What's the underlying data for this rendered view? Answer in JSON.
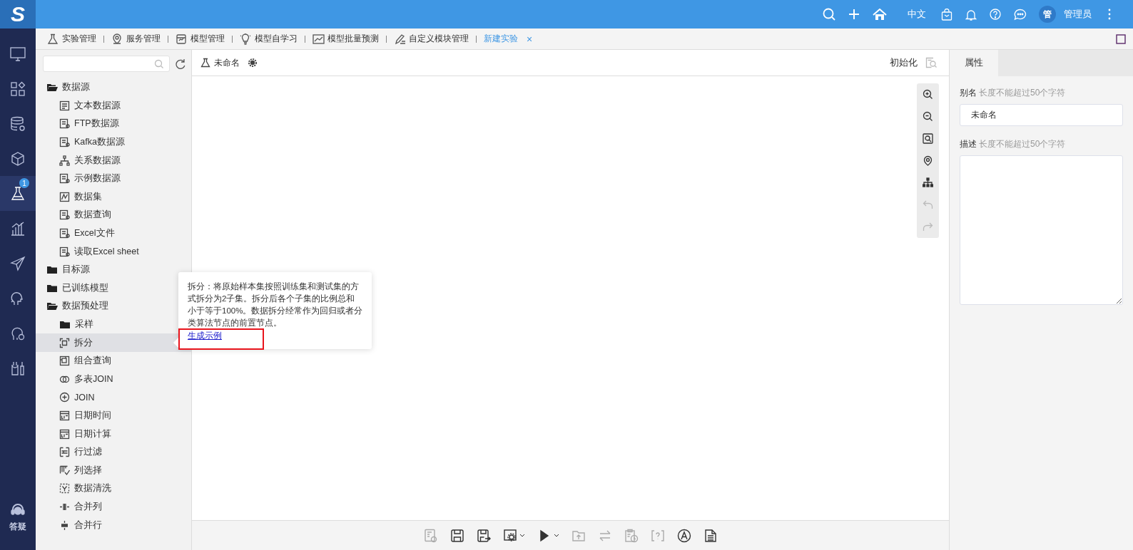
{
  "top_bar": {
    "logo_text": "S",
    "language": "中文",
    "avatar_text": "管",
    "user_name": "管理员"
  },
  "nav": {
    "items": [
      {
        "selected": false
      },
      {
        "selected": false
      },
      {
        "selected": false
      },
      {
        "selected": false
      },
      {
        "selected": true,
        "badge": "1"
      },
      {
        "selected": false
      },
      {
        "selected": false
      },
      {
        "selected": false
      },
      {
        "selected": false
      },
      {
        "selected": false
      }
    ],
    "help_label": "答疑"
  },
  "tabs": [
    {
      "label": "实验管理",
      "selected": false,
      "closable": false
    },
    {
      "label": "服务管理",
      "selected": false,
      "closable": false
    },
    {
      "label": "模型管理",
      "selected": false,
      "closable": false
    },
    {
      "label": "模型自学习",
      "selected": false,
      "closable": false
    },
    {
      "label": "模型批量预测",
      "selected": false,
      "closable": false
    },
    {
      "label": "自定义模块管理",
      "selected": false,
      "closable": false
    },
    {
      "label": "新建实验",
      "selected": true,
      "closable": true,
      "close_glyph": "×"
    }
  ],
  "tree": {
    "items": [
      {
        "label": "数据源",
        "kind": "folder",
        "expanded": true,
        "selected": false,
        "children": [
          {
            "label": "文本数据源",
            "kind": "leaf",
            "selected": false
          },
          {
            "label": "FTP数据源",
            "kind": "leaf",
            "selected": false
          },
          {
            "label": "Kafka数据源",
            "kind": "leaf",
            "selected": false
          },
          {
            "label": "关系数据源",
            "kind": "leaf",
            "selected": false
          },
          {
            "label": "示例数据源",
            "kind": "leaf",
            "selected": false
          },
          {
            "label": "数据集",
            "kind": "leaf",
            "selected": false
          },
          {
            "label": "数据查询",
            "kind": "leaf",
            "selected": false
          },
          {
            "label": "Excel文件",
            "kind": "leaf",
            "selected": false
          },
          {
            "label": "读取Excel sheet",
            "kind": "leaf",
            "selected": false
          }
        ]
      },
      {
        "label": "目标源",
        "kind": "folder",
        "expanded": false,
        "selected": false
      },
      {
        "label": "已训练模型",
        "kind": "folder",
        "expanded": false,
        "selected": false
      },
      {
        "label": "数据预处理",
        "kind": "folder",
        "expanded": true,
        "selected": false,
        "children": [
          {
            "label": "采样",
            "kind": "folder",
            "expanded": false,
            "selected": false
          },
          {
            "label": "拆分",
            "kind": "leaf",
            "selected": true
          },
          {
            "label": "组合查询",
            "kind": "leaf",
            "selected": false
          },
          {
            "label": "多表JOIN",
            "kind": "leaf",
            "selected": false
          },
          {
            "label": "JOIN",
            "kind": "leaf",
            "selected": false
          },
          {
            "label": "日期时间",
            "kind": "leaf",
            "selected": false
          },
          {
            "label": "日期计算",
            "kind": "leaf",
            "selected": false
          },
          {
            "label": "行过滤",
            "kind": "leaf",
            "selected": false
          },
          {
            "label": "列选择",
            "kind": "leaf",
            "selected": false
          },
          {
            "label": "数据清洗",
            "kind": "leaf",
            "selected": false
          },
          {
            "label": "合并列",
            "kind": "leaf",
            "selected": false
          },
          {
            "label": "合并行",
            "kind": "leaf",
            "selected": false
          }
        ]
      }
    ]
  },
  "canvas": {
    "title": "未命名",
    "init_label": "初始化",
    "zoom_tools": [
      {
        "disabled": false
      },
      {
        "disabled": false
      },
      {
        "disabled": false
      },
      {
        "disabled": false
      },
      {
        "disabled": false
      },
      {
        "disabled": true
      },
      {
        "disabled": true
      }
    ],
    "bottom_tools": [
      {
        "disabled": true,
        "dropdown": false
      },
      {
        "disabled": false,
        "dropdown": false
      },
      {
        "disabled": false,
        "dropdown": false
      },
      {
        "disabled": false,
        "dropdown": true
      },
      {
        "disabled": false,
        "dropdown": true
      },
      {
        "disabled": true,
        "dropdown": false
      },
      {
        "disabled": true,
        "dropdown": false
      },
      {
        "disabled": true,
        "dropdown": false
      },
      {
        "disabled": true,
        "dropdown": false
      },
      {
        "disabled": false,
        "dropdown": false
      },
      {
        "disabled": false,
        "dropdown": false
      }
    ]
  },
  "tooltip": {
    "text": "拆分：将原始样本集按照训练集和测试集的方式拆分为2子集。拆分后各个子集的比例总和小于等于100%。数据拆分经常作为回归或者分类算法节点的前置节点。",
    "link": "生成示例",
    "highlighted": true
  },
  "properties": {
    "tab": {
      "label": "属性",
      "selected": true
    },
    "fields": [
      {
        "kind": "input",
        "label": "别名",
        "note": "长度不能超过50个字符",
        "value": "未命名"
      },
      {
        "kind": "textarea",
        "label": "描述",
        "note": "长度不能超过50个字符"
      }
    ]
  }
}
